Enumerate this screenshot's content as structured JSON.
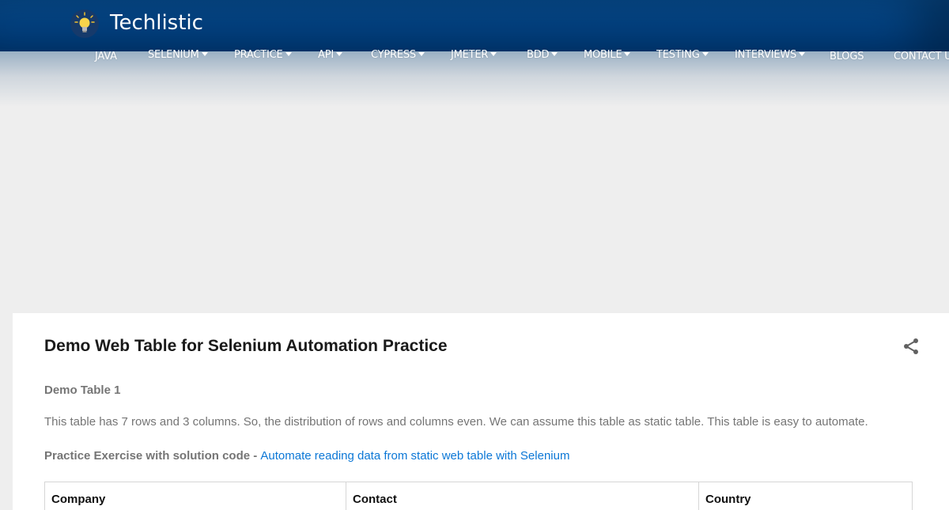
{
  "header": {
    "site_title": "Techlistic",
    "logo_icon": "lightbulb-icon"
  },
  "nav": {
    "items": [
      {
        "label": "JAVA",
        "dropdown": false
      },
      {
        "label": "SELENIUM",
        "dropdown": true
      },
      {
        "label": "PRACTICE",
        "dropdown": true
      },
      {
        "label": "API",
        "dropdown": true
      },
      {
        "label": "CYPRESS",
        "dropdown": true
      },
      {
        "label": "JMETER",
        "dropdown": true
      },
      {
        "label": "BDD",
        "dropdown": true
      },
      {
        "label": "MOBILE",
        "dropdown": true
      },
      {
        "label": "TESTING",
        "dropdown": true
      },
      {
        "label": "INTERVIEWS",
        "dropdown": true
      },
      {
        "label": "BLOGS",
        "dropdown": false
      },
      {
        "label": "CONTACT U",
        "dropdown": false
      }
    ]
  },
  "post": {
    "title": "Demo Web Table for Selenium Automation Practice",
    "share_icon": "share-icon",
    "sub_heading": "Demo Table 1",
    "paragraph": "This table has 7 rows and 3 columns. So, the distribution of rows and columns even. We can assume this table as static table. This table is easy to automate.",
    "exercise_label": "Practice Exercise with solution code - ",
    "exercise_link": "Automate reading data from static web table with Selenium",
    "table_headers": [
      "Company",
      "Contact",
      "Country"
    ]
  },
  "colors": {
    "header_blue": "#064d92",
    "link_blue": "#0b77d6",
    "text_gray": "#757575"
  }
}
